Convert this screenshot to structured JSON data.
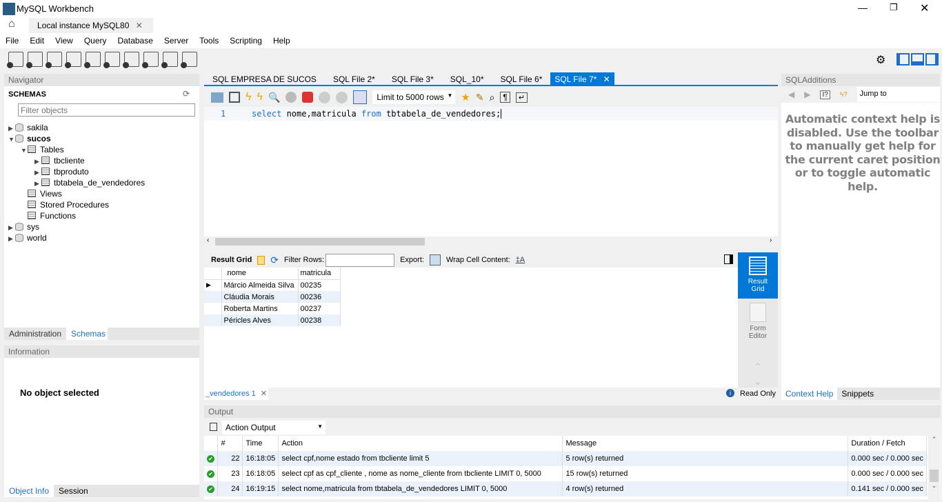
{
  "window": {
    "title": "MySQL Workbench",
    "connection_tab": "Local instance MySQL80"
  },
  "menu": [
    "File",
    "Edit",
    "View",
    "Query",
    "Database",
    "Server",
    "Tools",
    "Scripting",
    "Help"
  ],
  "navigator": {
    "header": "Navigator",
    "schemas_label": "SCHEMAS",
    "filter_placeholder": "Filter objects",
    "tree": {
      "sakila": "sakila",
      "sucos": "sucos",
      "tables": "Tables",
      "tables_list": [
        "tbcliente",
        "tbproduto",
        "tbtabela_de_vendedores"
      ],
      "views": "Views",
      "procs": "Stored Procedures",
      "funcs": "Functions",
      "sys": "sys",
      "world": "world"
    },
    "tabs": [
      "Administration",
      "Schemas"
    ]
  },
  "information": {
    "header": "Information",
    "text": "No object selected",
    "tabs": [
      "Object Info",
      "Session"
    ]
  },
  "editor": {
    "tabs": [
      "SQL EMPRESA DE SUCOS",
      "SQL File 2*",
      "SQL File 3*",
      "SQL_10*",
      "SQL File 6*",
      "SQL File 7*"
    ],
    "limit": "Limit to 5000 rows",
    "line_number": "1",
    "code": {
      "kw1": "select",
      "p1": " nome,matricula ",
      "kw2": "from",
      "p2": " tbtabela_de_vendedores;"
    }
  },
  "result": {
    "toolbar": {
      "result_grid": "Result Grid",
      "filter_rows": "Filter Rows:",
      "export": "Export:",
      "wrap": "Wrap Cell Content:"
    },
    "columns": [
      "nome",
      "matricula"
    ],
    "rows": [
      [
        "Márcio Almeida Silva",
        "00235"
      ],
      [
        "Cláudia Morais",
        "00236"
      ],
      [
        "Roberta Martins",
        "00237"
      ],
      [
        " Péricles Alves",
        "00238"
      ]
    ],
    "side": {
      "result_grid": "Result Grid",
      "form_editor": "Form Editor"
    },
    "bottom_tab": "_vendedores 1",
    "read_only": "Read Only"
  },
  "sqladditions": {
    "header": "SQLAdditions",
    "jump_to": "Jump to",
    "help": "Automatic context help is disabled. Use the toolbar to manually get help for the current caret position or to toggle automatic help.",
    "tabs": [
      "Context Help",
      "Snippets"
    ]
  },
  "output": {
    "header": "Output",
    "selector": "Action Output",
    "columns": [
      "#",
      "Time",
      "Action",
      "Message",
      "Duration / Fetch"
    ],
    "rows": [
      {
        "n": "22",
        "time": "16:18:05",
        "action": "select cpf,nome estado from tbcliente limit 5",
        "message": "5 row(s) returned",
        "duration": "0.000 sec / 0.000 sec"
      },
      {
        "n": "23",
        "time": "16:18:05",
        "action": "select cpf as cpf_cliente , nome as  nome_cliente from tbcliente LIMIT 0, 5000",
        "message": "15 row(s) returned",
        "duration": "0.000 sec / 0.000 sec"
      },
      {
        "n": "24",
        "time": "16:19:15",
        "action": "select nome,matricula from tbtabela_de_vendedores LIMIT 0, 5000",
        "message": "4 row(s) returned",
        "duration": "0.141 sec / 0.000 sec"
      }
    ]
  },
  "colors": {
    "accent": "#0078d7",
    "keyword": "#1c6fc4",
    "status_ok": "#2a9d2a"
  }
}
